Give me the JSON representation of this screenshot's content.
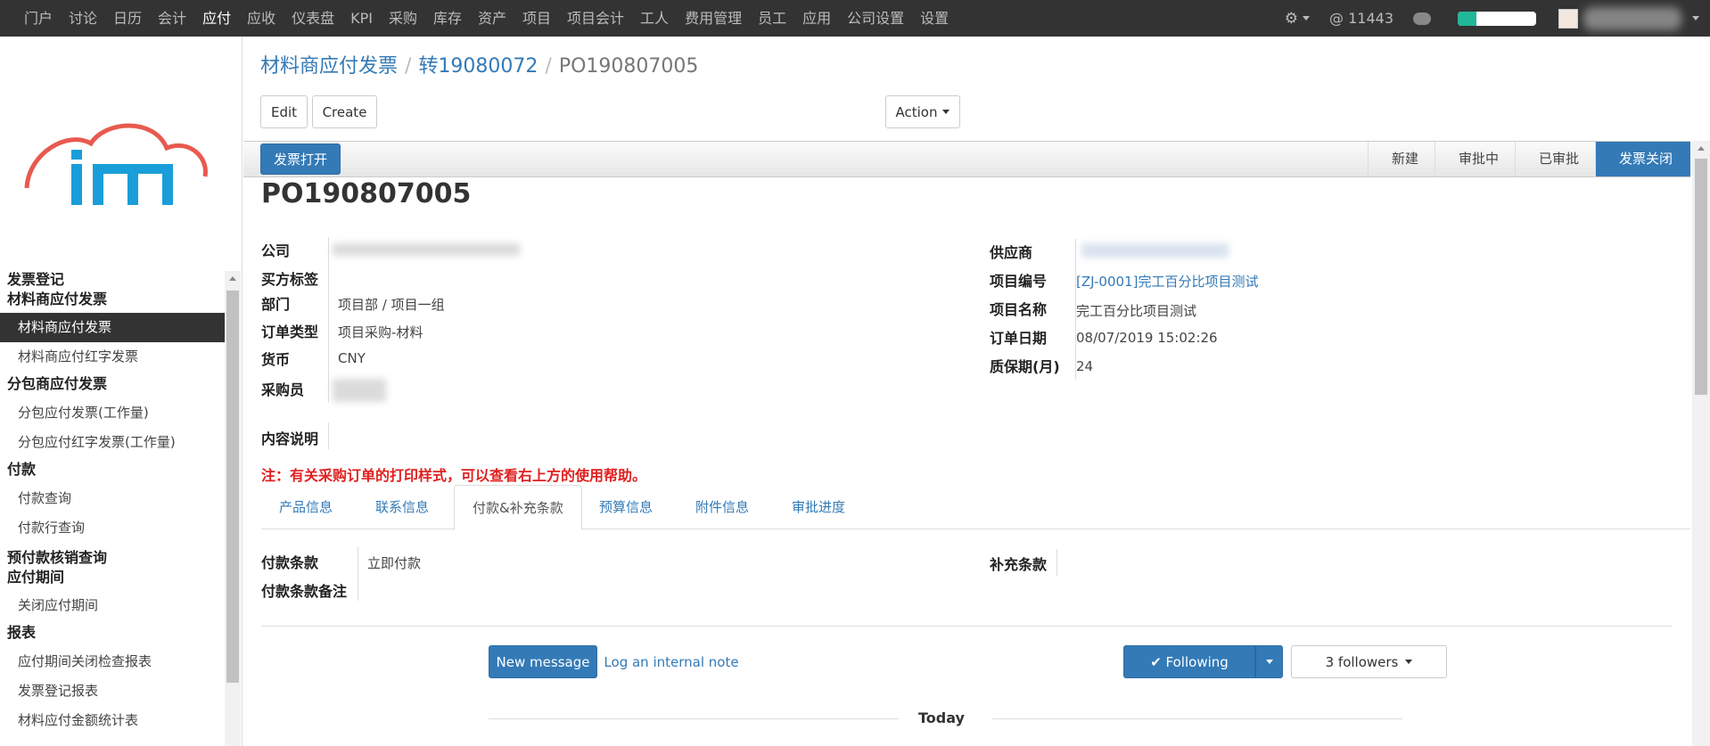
{
  "topnav": {
    "items": [
      "门户",
      "讨论",
      "日历",
      "会计",
      "应付",
      "应收",
      "仪表盘",
      "KPI",
      "采购",
      "库存",
      "资产",
      "项目",
      "项目会计",
      "工人",
      "费用管理",
      "员工",
      "应用",
      "公司设置",
      "设置"
    ],
    "active_index": 4,
    "mentions": "@ 11443",
    "progress_percent": 24,
    "progress_color": "#21b799"
  },
  "sidebar": {
    "groups": [
      {
        "label": "发票登记",
        "items": []
      },
      {
        "label": "材料商应付发票",
        "items": [
          "材料商应付发票",
          "材料商应付红字发票"
        ],
        "active": 0
      },
      {
        "label": "分包商应付发票",
        "items": [
          "分包应付发票(工作量)",
          "分包应付红字发票(工作量)"
        ]
      },
      {
        "label": "付款",
        "items": [
          "付款查询",
          "付款行查询"
        ]
      },
      {
        "label": "预付款核销查询",
        "items": []
      },
      {
        "label": "应付期间",
        "items": [
          "关闭应付期间"
        ]
      },
      {
        "label": "报表",
        "items": [
          "应付期间关闭检查报表",
          "发票登记报表",
          "材料应付金额统计表"
        ]
      }
    ]
  },
  "breadcrumb": {
    "first": "材料商应付发票",
    "second": "转19080072",
    "current": "PO190807005"
  },
  "toolbar": {
    "edit": "Edit",
    "create": "Create",
    "action": "Action"
  },
  "statusbar": {
    "open_button": "发票打开",
    "stages": [
      "新建",
      "审批中",
      "已审批",
      "发票关闭"
    ],
    "current_stage": 3,
    "accent": "#337ab7"
  },
  "record": {
    "title": "PO190807005",
    "left": [
      {
        "label": "公司",
        "value": ""
      },
      {
        "label": "买方标签",
        "value": ""
      },
      {
        "label": "部门",
        "value": "项目部 / 项目一组"
      },
      {
        "label": "订单类型",
        "value": "项目采购-材料"
      },
      {
        "label": "货币",
        "value": "CNY"
      },
      {
        "label": "采购员",
        "value": ""
      }
    ],
    "right": [
      {
        "label": "供应商",
        "value": ""
      },
      {
        "label": "项目编号",
        "value": "[ZJ-0001]完工百分比项目测试"
      },
      {
        "label": "项目名称",
        "value": "完工百分比项目测试"
      },
      {
        "label": "订单日期",
        "value": "08/07/2019 15:02:26"
      },
      {
        "label": "质保期(月)",
        "value": "24"
      }
    ],
    "desc_label": "内容说明",
    "note": "注：有关采购订单的打印样式，可以查看右上方的使用帮助。",
    "note_color": "#e02020"
  },
  "tabs": {
    "items": [
      "产品信息",
      "联系信息",
      "付款&补充条款",
      "预算信息",
      "附件信息",
      "审批进度"
    ],
    "active": 2
  },
  "payment": {
    "terms_label": "付款条款",
    "terms_value": "立即付款",
    "terms_note_label": "付款条款备注",
    "extra_label": "补充条款"
  },
  "chatter": {
    "new_message": "New message",
    "log_note": "Log an internal note",
    "following": "✔ Following",
    "followers": "3 followers",
    "today": "Today"
  }
}
